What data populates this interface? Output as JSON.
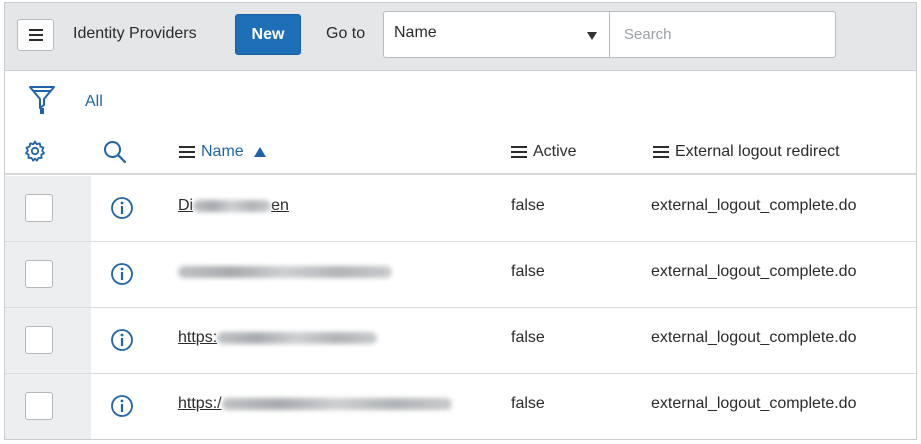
{
  "header": {
    "title": "Identity Providers",
    "new_label": "New",
    "goto_label": "Go to",
    "goto_field": "Name",
    "search_placeholder": "Search"
  },
  "filter": {
    "label": "All"
  },
  "columns": {
    "name": "Name",
    "active": "Active",
    "redirect": "External logout redirect"
  },
  "rows": [
    {
      "name": "Di",
      "name_suffix": "en",
      "blur_width": 0.55,
      "active": "false",
      "redirect": "external_logout_complete.do"
    },
    {
      "name": "",
      "name_suffix": "",
      "blur_width": 1.0,
      "active": "false",
      "redirect": "external_logout_complete.do"
    },
    {
      "name": "https:",
      "name_suffix": "",
      "blur_width": 0.7,
      "active": "false",
      "redirect": "external_logout_complete.do"
    },
    {
      "name": "https:/",
      "name_suffix": "",
      "blur_width": 1.05,
      "active": "false",
      "redirect": "external_logout_complete.do"
    }
  ],
  "colors": {
    "header_bg": "#e4e6e7",
    "primary_button": "#1f6fb8",
    "link_blue": "#1f64aa"
  },
  "icons": {
    "menu": "hamburger-icon",
    "filter": "funnel-icon",
    "personalize": "gear-icon",
    "column_search": "magnifier-icon",
    "row_preview": "info-circle-icon"
  }
}
